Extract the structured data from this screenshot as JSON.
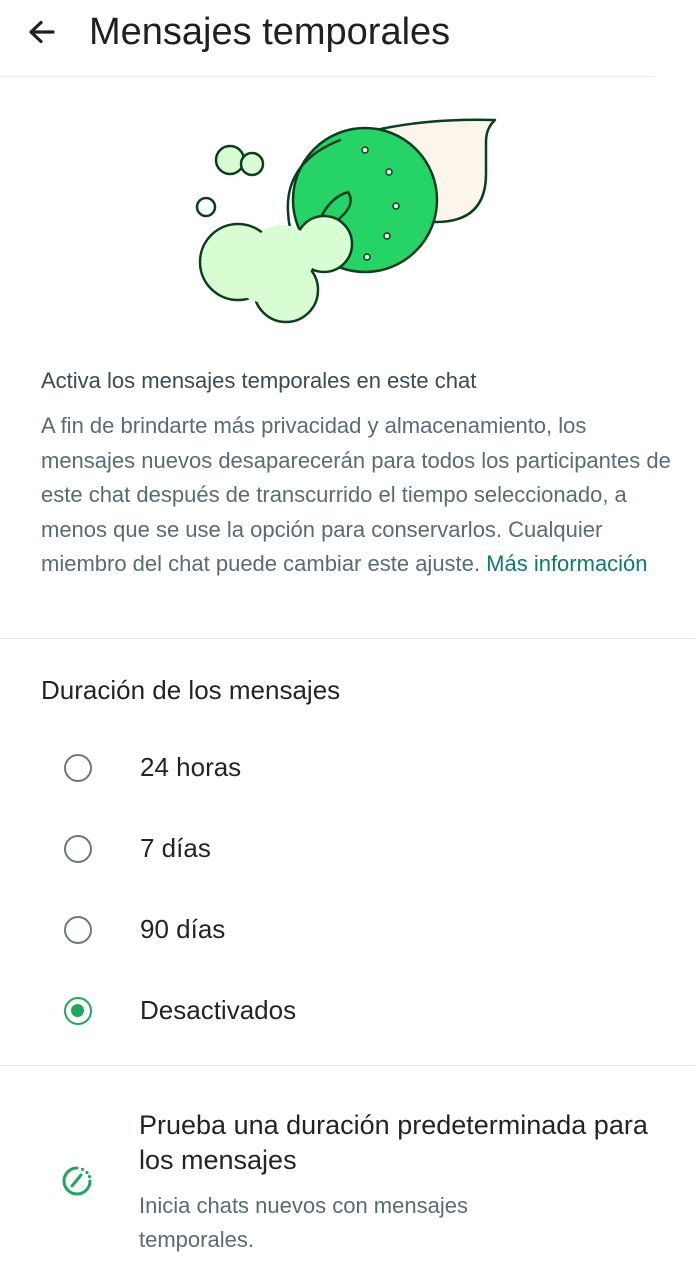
{
  "header": {
    "title": "Mensajes temporales",
    "back_icon": "arrow-left-icon"
  },
  "illustration": {
    "icon": "disappearing-messages-illustration",
    "colors": {
      "green": "#25d366",
      "light_green": "#d9fdd3",
      "cream": "#fcf5eb",
      "outline": "#0b3d1f"
    }
  },
  "info": {
    "title": "Activa los mensajes temporales en este chat",
    "body": "A fin de brindarte más privacidad y almacenamiento, los mensajes nuevos desaparecerán para todos los participantes de este chat después de transcurrido el tiempo seleccionado, a menos que se use la opción para conservarlos. Cualquier miembro del chat puede cambiar este ajuste.",
    "link": "Más información"
  },
  "duration": {
    "label": "Duración de los mensajes",
    "options": [
      {
        "label": "24 horas",
        "selected": false
      },
      {
        "label": "7 días",
        "selected": false
      },
      {
        "label": "90 días",
        "selected": false
      },
      {
        "label": "Desactivados",
        "selected": true
      }
    ]
  },
  "default_duration": {
    "title": "Prueba una duración predeterminada para los mensajes",
    "subtitle": "Inicia chats nuevos con mensajes temporales.",
    "icon": "timer-icon"
  },
  "colors": {
    "accent": "#1da85c",
    "link": "#0e7a6f",
    "text_primary": "#1f2427",
    "text_secondary": "#5b6a73"
  }
}
